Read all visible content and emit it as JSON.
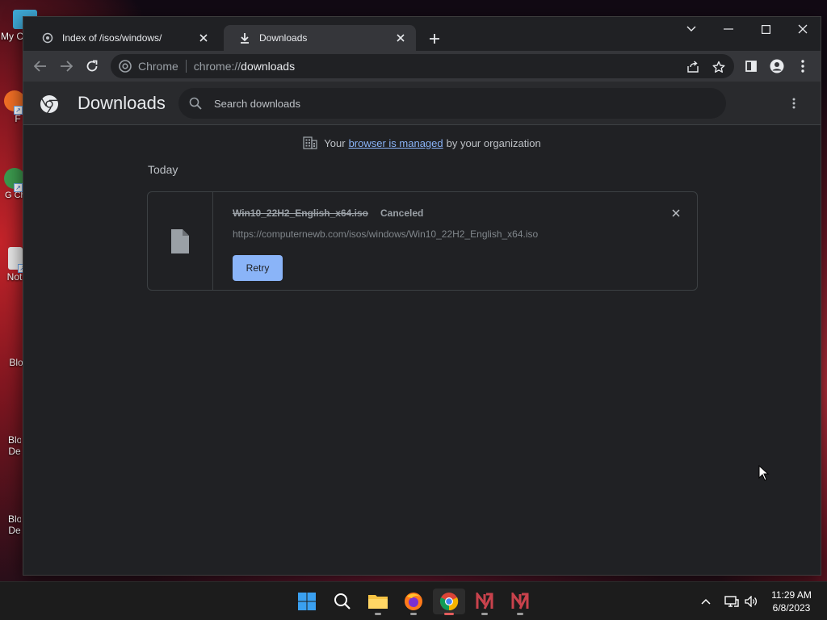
{
  "desktop": {
    "icons": [
      {
        "label": "My C"
      },
      {
        "label": "F"
      },
      {
        "label": "G Ch"
      },
      {
        "label": "Not"
      },
      {
        "label": "Blo"
      },
      {
        "label": "Blo De"
      },
      {
        "label": "Blo De"
      }
    ]
  },
  "browser": {
    "tabs": [
      {
        "title": "Index of /isos/windows/",
        "active": false,
        "icon": "tab-favicon-icon"
      },
      {
        "title": "Downloads",
        "active": true,
        "icon": "download-icon"
      }
    ],
    "omnibox": {
      "chip": "Chrome",
      "url_scheme": "chrome://",
      "url_path": "downloads"
    }
  },
  "page": {
    "title": "Downloads",
    "search_placeholder": "Search downloads",
    "managed_prefix": "Your",
    "managed_link": "browser is managed",
    "managed_suffix": "by your organization",
    "section_label": "Today",
    "download": {
      "filename": "Win10_22H2_English_x64.iso",
      "status": "Canceled",
      "url": "https://computernewb.com/isos/windows/Win10_22H2_English_x64.iso",
      "retry_label": "Retry"
    }
  },
  "taskbar": {
    "apps": [
      "start-icon",
      "search-icon",
      "file-explorer-icon",
      "firefox-icon",
      "chrome-icon",
      "app-icon-1",
      "app-icon-2"
    ],
    "active_app": "chrome-icon",
    "time": "11:29 AM",
    "date": "6/8/2023"
  },
  "colors": {
    "accent": "#8ab4f8",
    "page_bg": "#202124",
    "toolbar_bg": "#35363a",
    "text": "#e8eaed"
  }
}
